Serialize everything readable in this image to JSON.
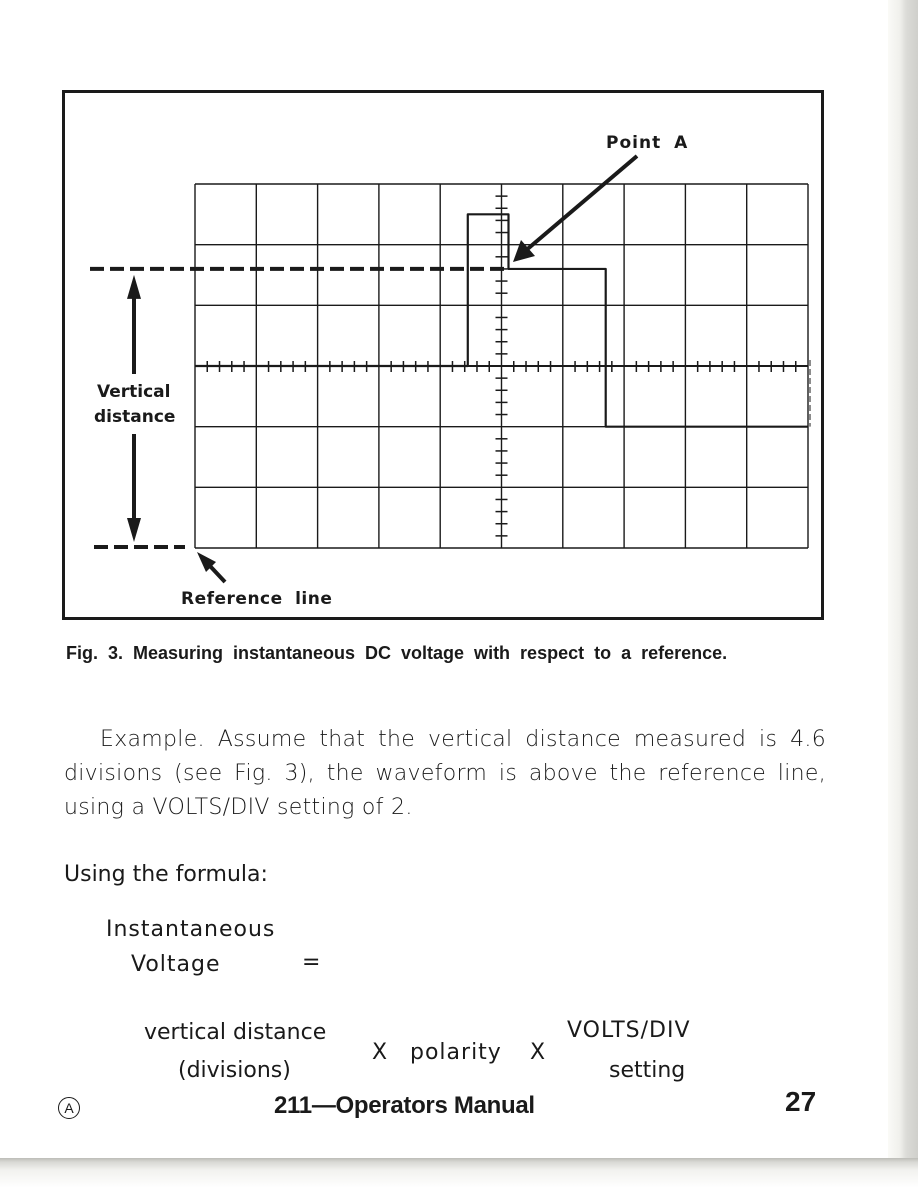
{
  "figure": {
    "point_label": "Point A",
    "vertical_distance_label_line1": "Vertical",
    "vertical_distance_label_line2": "distance",
    "reference_line_label": "Reference line",
    "graticule": {
      "horizontal_divisions": 10,
      "vertical_divisions": 6,
      "minor_ticks_per_division": 5
    },
    "waveform_levels_divisions_above_reference": {
      "baseline_left": 3.0,
      "pulse_peak": 5.5,
      "point_a_level": 4.6,
      "low_right": 2.0
    },
    "measured_vertical_distance_divisions": 4.6
  },
  "caption": "Fig. 3. Measuring instantaneous DC voltage with respect to a reference.",
  "body": {
    "example_paragraph": "Example. Assume that the vertical distance measured is 4.6 divisions (see Fig. 3), the waveform is above the reference line, using a VOLTS/DIV setting of 2.",
    "formula_intro": "Using the formula:"
  },
  "formula": {
    "lhs_line1": "Instantaneous",
    "lhs_line2": "Voltage",
    "equals": "=",
    "term1_line1": "vertical distance",
    "term1_line2": "(divisions)",
    "times1": "X",
    "term2": "polarity",
    "times2": "X",
    "term3_line1": "VOLTS/DIV",
    "term3_line2": "setting"
  },
  "footer": {
    "revision_mark": "A",
    "manual_title": "211—Operators Manual",
    "page_number": "27"
  }
}
